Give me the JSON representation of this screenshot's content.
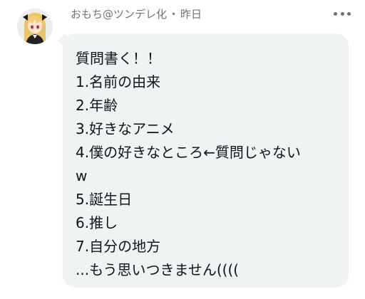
{
  "tweet": {
    "author_name": "おもち@ツンデレ化",
    "separator": "・",
    "timestamp": "昨日",
    "more_icon": "more-horizontal-icon",
    "avatar_icon": "avatar-image",
    "bubble_color": "#eff3f4",
    "body_lines": [
      "質問書く！！",
      "1.名前の由来",
      "2.年齢",
      "3.好きなアニメ",
      "4.僕の好きなところ←質問じゃない",
      "w",
      "5.誕生日",
      "6.推し",
      "7.自分の地方",
      "...もう思いつきません(((("
    ]
  }
}
